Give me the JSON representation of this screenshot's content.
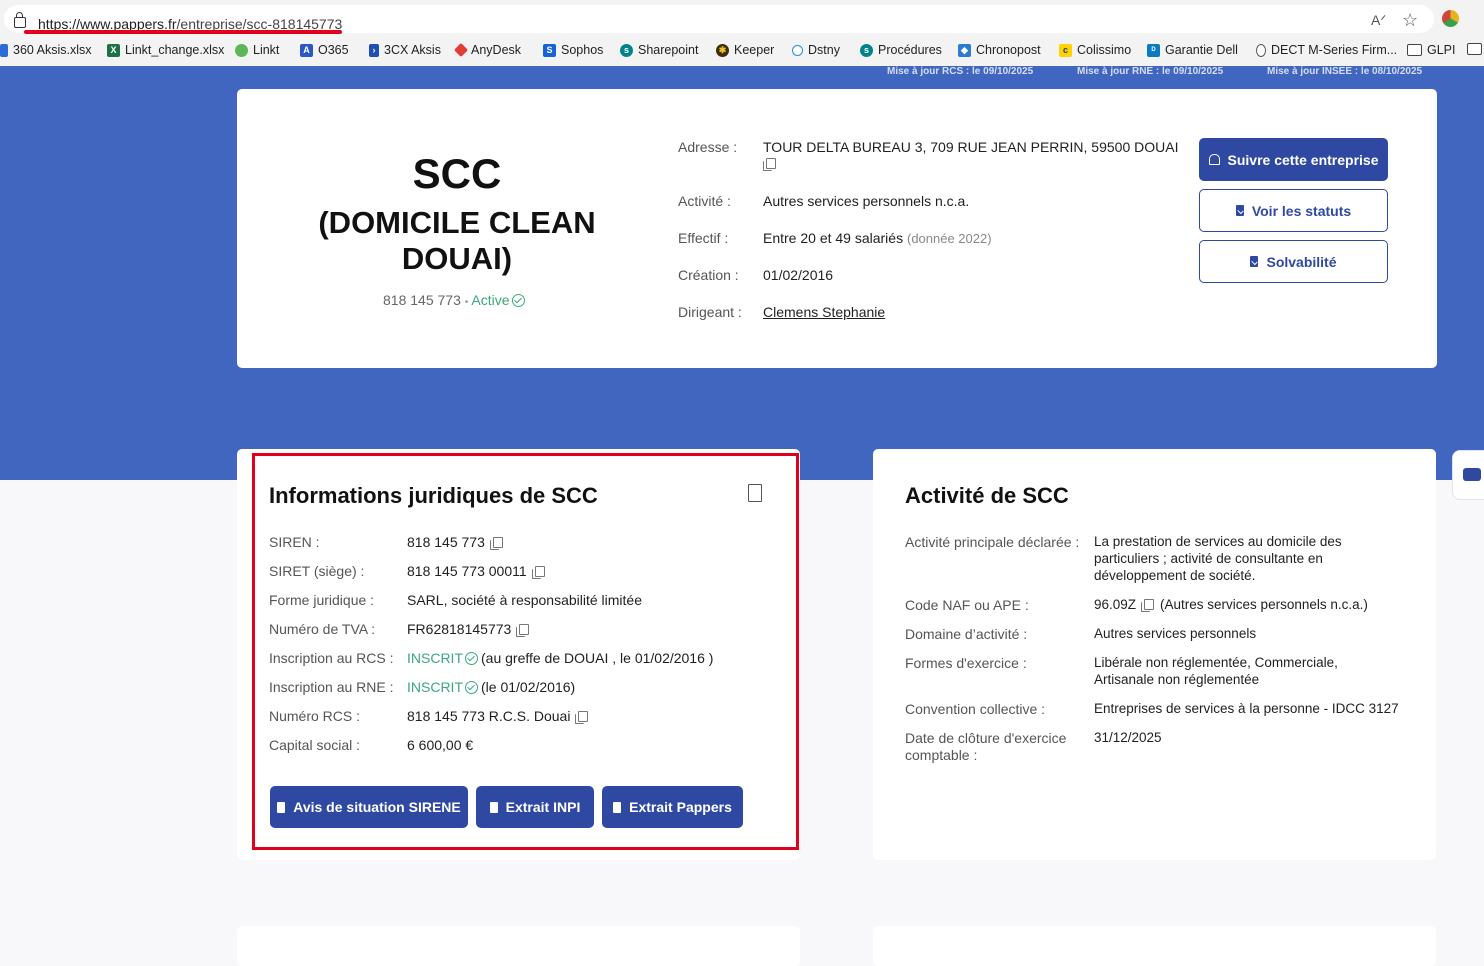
{
  "browser": {
    "url_host": "https://www.pappers.fr",
    "url_path": "/entreprise/scc-818145773",
    "bookmarks": [
      "360 Aksis.xlsx",
      "Linkt_change.xlsx",
      "Linkt",
      "O365",
      "3CX Aksis",
      "AnyDesk",
      "Sophos",
      "Sharepoint",
      "Keeper",
      "Dstny",
      "Procédures",
      "Chronopost",
      "Colissimo",
      "Garantie Dell",
      "DECT M-Series Firm...",
      "GLPI"
    ]
  },
  "updates": {
    "rcs": "Mise à jour RCS : le 09/10/2025",
    "rne": "Mise à jour RNE : le 09/10/2025",
    "insee": "Mise à jour INSEE : le 08/10/2025"
  },
  "company": {
    "name": "SCC",
    "name_line2": "(DOMICILE CLEAN",
    "name_line3": "DOUAI)",
    "siren": "818 145 773",
    "status": "Active",
    "labels": {
      "address": "Adresse :",
      "activity": "Activité :",
      "staff": "Effectif :",
      "creation": "Création :",
      "director": "Dirigeant :"
    },
    "address": "TOUR DELTA BUREAU 3, 709 RUE JEAN PERRIN, 59500 DOUAI",
    "activity": "Autres services personnels n.c.a.",
    "staff": "Entre 20 et 49 salariés",
    "staff_note": "(donnée 2022)",
    "creation": "01/02/2016",
    "director": "Clemens Stephanie",
    "buttons": {
      "follow": "Suivre cette entreprise",
      "statutes": "Voir les statuts",
      "solvency": "Solvabilité"
    }
  },
  "legal": {
    "title": "Informations juridiques de SCC",
    "rows": [
      {
        "label": "SIREN :",
        "value": "818 145 773"
      },
      {
        "label": "SIRET (siège) :",
        "value": "818 145 773 00011"
      },
      {
        "label": "Forme juridique :",
        "value": "SARL, société à responsabilité limitée"
      },
      {
        "label": "Numéro de TVA :",
        "value": "FR62818145773"
      },
      {
        "label": "Inscription au RCS :",
        "status": "INSCRIT",
        "value": "(au greffe de DOUAI , le 01/02/2016 )"
      },
      {
        "label": "Inscription au RNE :",
        "status": "INSCRIT",
        "value": "(le 01/02/2016)"
      },
      {
        "label": "Numéro RCS :",
        "value": "818 145 773 R.C.S. Douai"
      },
      {
        "label": "Capital social :",
        "value": "6 600,00 €"
      }
    ],
    "buttons": {
      "sirene": "Avis de situation SIRENE",
      "inpi": "Extrait INPI",
      "pappers": "Extrait Pappers"
    }
  },
  "activity": {
    "title": "Activité de SCC",
    "rows": [
      {
        "label": "Activité principale déclarée :",
        "lines": [
          "La prestation de services au domicile des",
          "particuliers ; activité de consultante en",
          "développement de société."
        ]
      },
      {
        "label": "Code NAF ou APE :",
        "code": "96.09Z",
        "lines": [
          "(Autres services personnels n.c.a.)"
        ]
      },
      {
        "label": "Domaine d’activité :",
        "lines": [
          "Autres services personnels"
        ]
      },
      {
        "label": "Formes d'exercice :",
        "lines": [
          "Libérale non réglementée, Commerciale,",
          "Artisanale non réglementée"
        ]
      },
      {
        "label": "Convention collective :",
        "lines": [
          "Entreprises de services à la personne - IDCC 3127"
        ]
      },
      {
        "label": "Date de clôture d'exercice",
        "label2": "comptable :",
        "lines": [
          "31/12/2025"
        ]
      }
    ]
  }
}
